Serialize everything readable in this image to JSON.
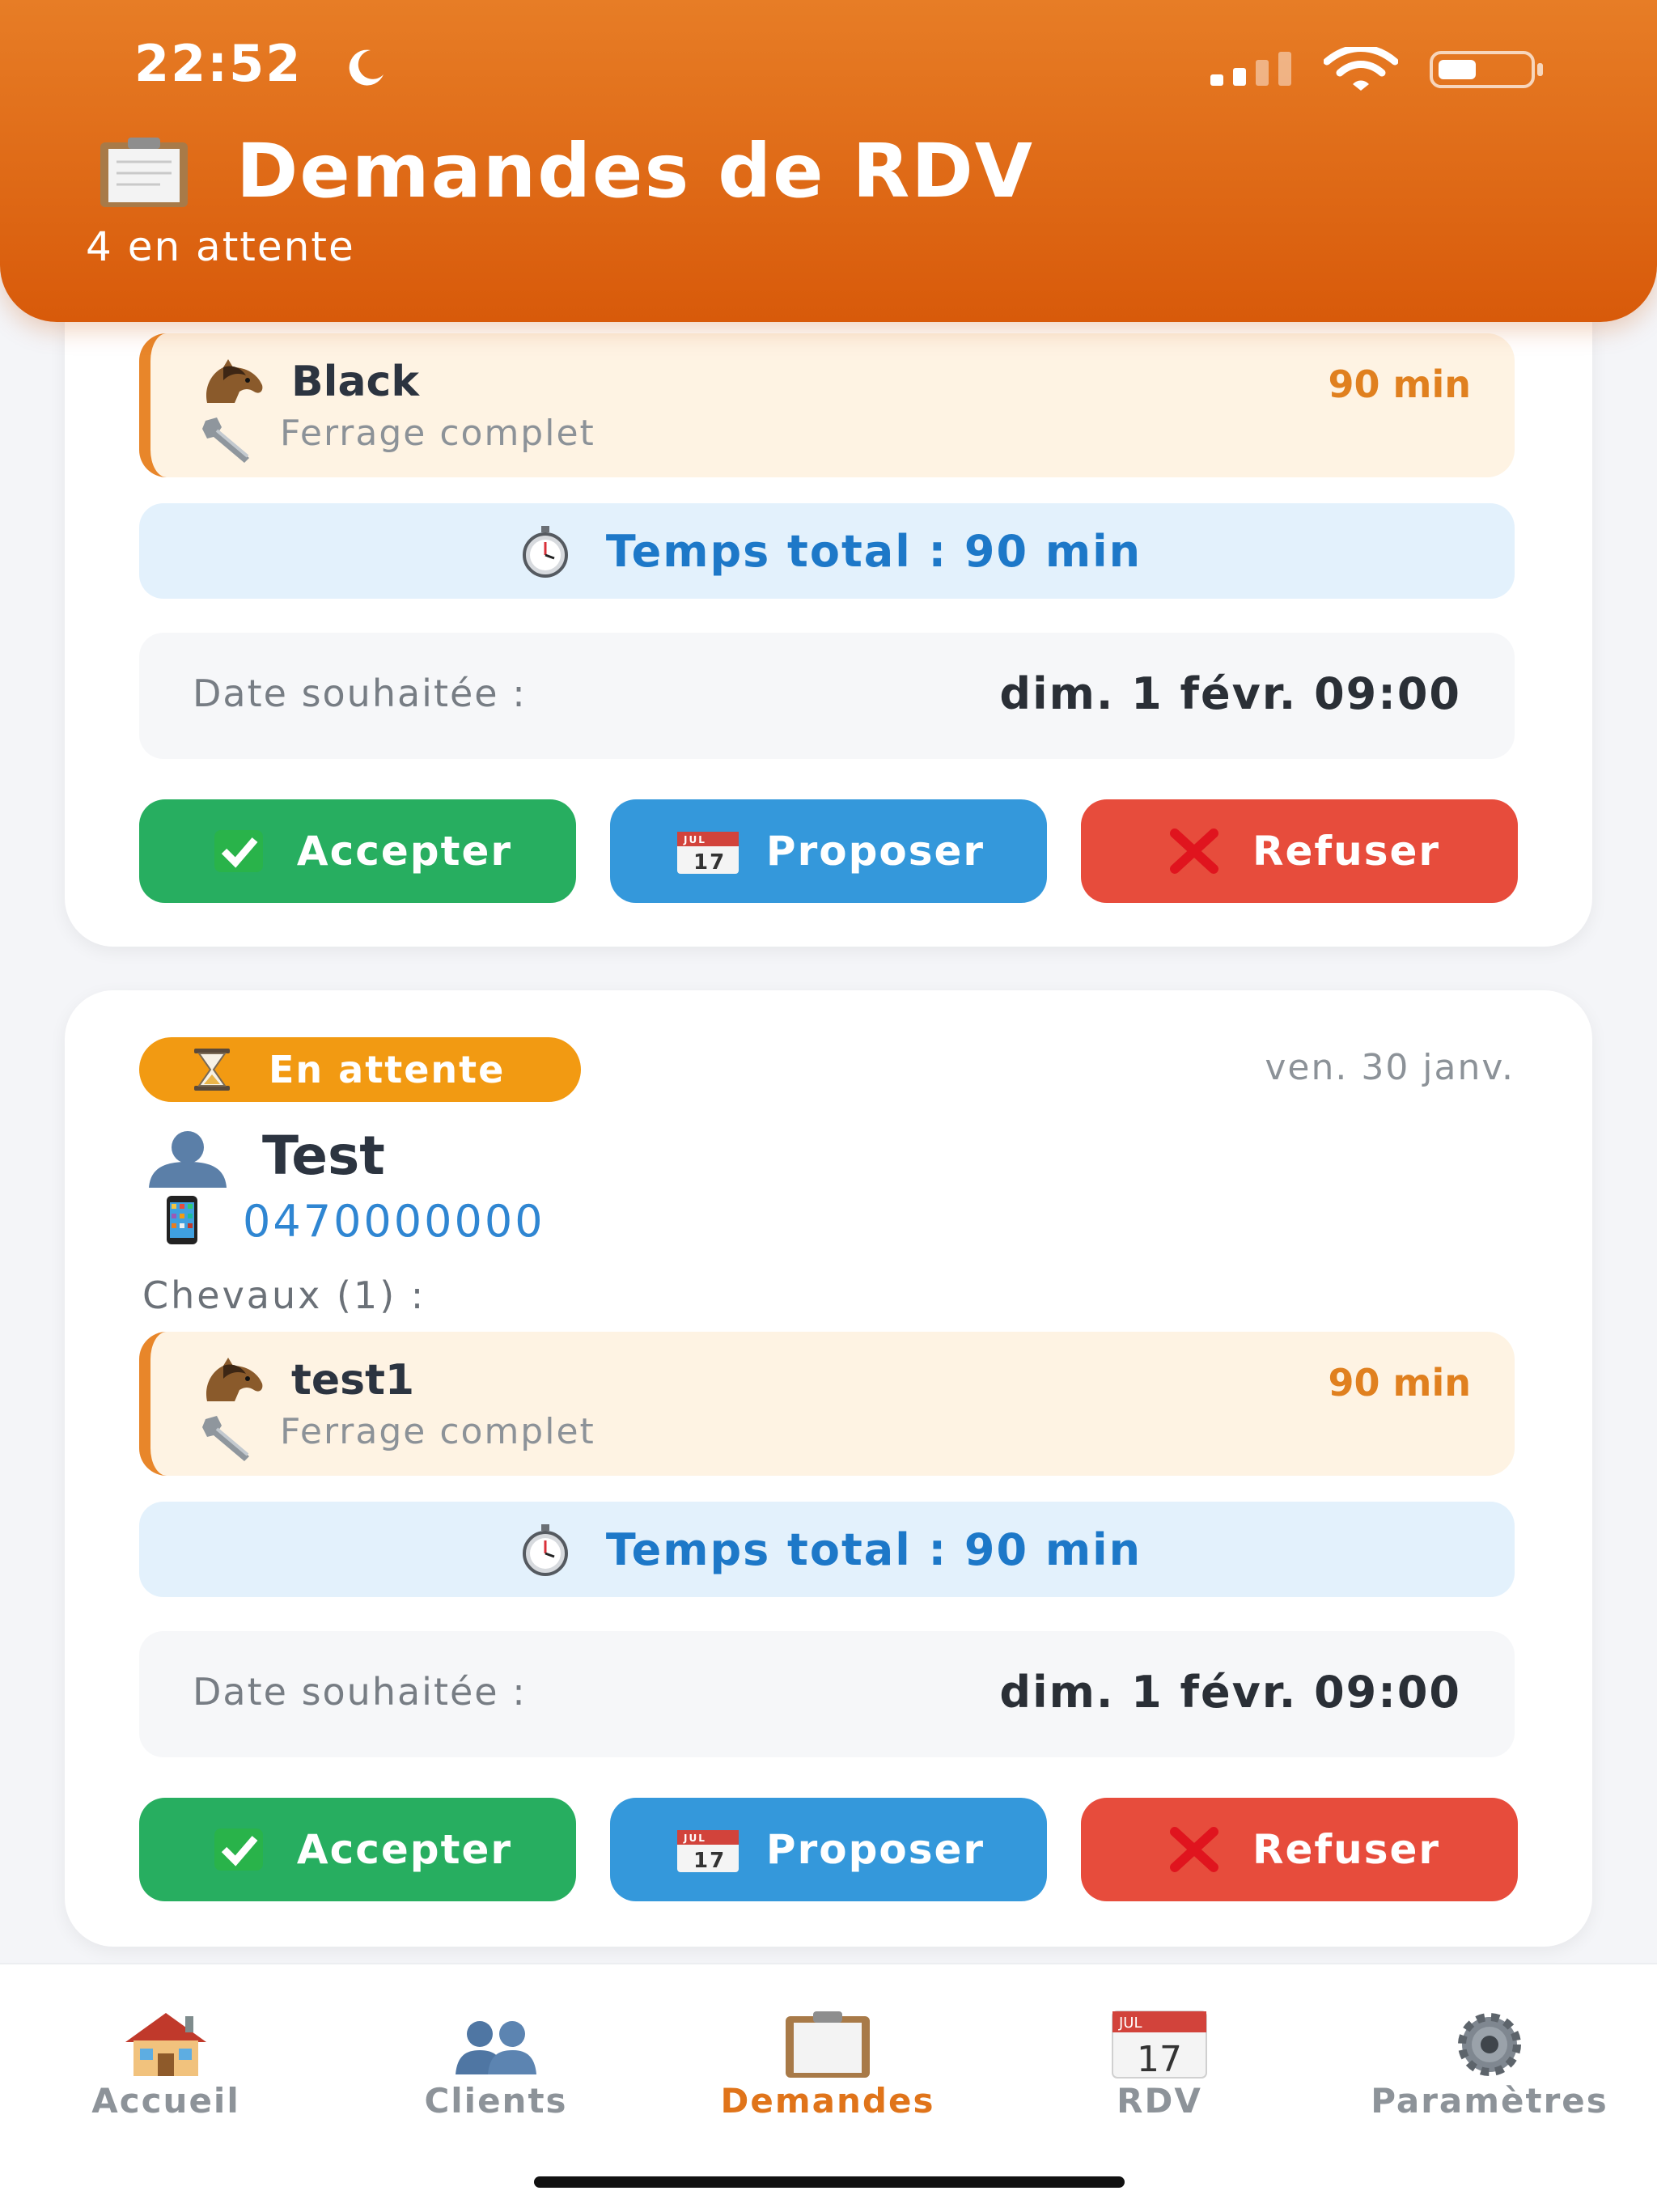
{
  "status_bar": {
    "time": "22:52"
  },
  "header": {
    "title": "Demandes de RDV",
    "subtitle": "4 en attente"
  },
  "requests": [
    {
      "horse": {
        "name": "Black",
        "duration": "90 min",
        "service": "Ferrage complet"
      },
      "total": "Temps total : 90 min",
      "date_label": "Date souhaitée :",
      "date_value": "dim. 1 févr. 09:00",
      "actions": {
        "accept": "Accepter",
        "propose": "Proposer",
        "refuse": "Refuser"
      }
    },
    {
      "status": "En attente",
      "request_date": "ven. 30 janv.",
      "client": {
        "name": "Test",
        "phone": "0470000000"
      },
      "horses_label": "Chevaux (1) :",
      "horse": {
        "name": "test1",
        "duration": "90 min",
        "service": "Ferrage complet"
      },
      "total": "Temps total : 90 min",
      "date_label": "Date souhaitée :",
      "date_value": "dim. 1 févr. 09:00",
      "actions": {
        "accept": "Accepter",
        "propose": "Proposer",
        "refuse": "Refuser"
      }
    }
  ],
  "calendar_icon": {
    "month": "JUL",
    "day": "17"
  },
  "tabs": [
    {
      "label": "Accueil",
      "icon": "house-icon"
    },
    {
      "label": "Clients",
      "icon": "users-icon"
    },
    {
      "label": "Demandes",
      "icon": "clipboard-icon",
      "active": true
    },
    {
      "label": "RDV",
      "icon": "calendar-icon"
    },
    {
      "label": "Paramètres",
      "icon": "gear-icon"
    }
  ],
  "colors": {
    "header_orange": "#e0680f",
    "accept_green": "#27ae60",
    "propose_blue": "#3498db",
    "refuse_red": "#e74c3c",
    "pending_badge": "#f29a12",
    "active_tab": "#e0741a"
  }
}
